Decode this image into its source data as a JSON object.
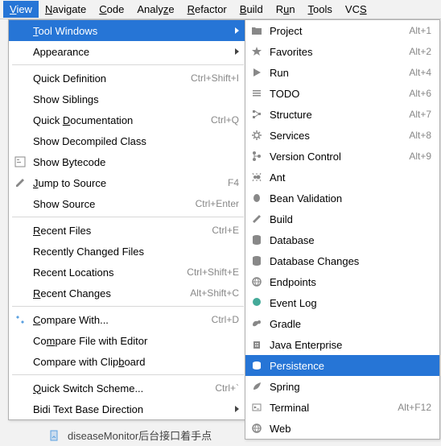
{
  "menubar": {
    "view": "View",
    "view_mn": "V",
    "navigate": "Navigate",
    "navigate_mn": "N",
    "code": "Code",
    "code_mn": "C",
    "analyze": "Analyze",
    "analyze_mn": "z",
    "refactor": "Refactor",
    "refactor_mn": "R",
    "build": "Build",
    "build_mn": "B",
    "run": "Run",
    "run_mn": "u",
    "tools": "Tools",
    "tools_mn": "T",
    "vcs": "VCS",
    "vcs_mn": "S"
  },
  "view_menu": {
    "tool_windows": "Tool Windows",
    "tw_mn": "T",
    "appearance": "Appearance",
    "quick_def": "Quick Definition",
    "quick_def_sc": "Ctrl+Shift+I",
    "show_siblings": "Show Siblings",
    "quick_doc": "Quick Documentation",
    "quick_doc_mn": "D",
    "quick_doc_sc": "Ctrl+Q",
    "show_decompiled": "Show Decompiled Class",
    "show_bytecode": "Show Bytecode",
    "jump_source": "Jump to Source",
    "jump_mn": "J",
    "jump_sc": "F4",
    "show_source": "Show Source",
    "show_source_sc": "Ctrl+Enter",
    "recent_files": "Recent Files",
    "rf_mn": "R",
    "rf_sc": "Ctrl+E",
    "recently_changed": "Recently Changed Files",
    "recent_locations": "Recent Locations",
    "rl_sc": "Ctrl+Shift+E",
    "recent_changes": "Recent Changes",
    "rc_mn": "R",
    "rc_sc": "Alt+Shift+C",
    "compare_with": "Compare With...",
    "cw_mn": "C",
    "cw_sc": "Ctrl+D",
    "compare_file_editor": "Compare File with Editor",
    "cfe_mn": "m",
    "compare_clipboard": "Compare with Clipboard",
    "cc_mn": "b",
    "quick_switch": "Quick Switch Scheme...",
    "qs_mn": "Q",
    "qs_sc": "Ctrl+`",
    "bidi": "Bidi Text Base Direction"
  },
  "tool_windows": {
    "project": "Project",
    "project_sc": "Alt+1",
    "favorites": "Favorites",
    "fav_sc": "Alt+2",
    "run": "Run",
    "run_sc": "Alt+4",
    "todo": "TODO",
    "todo_sc": "Alt+6",
    "structure": "Structure",
    "struct_sc": "Alt+7",
    "services": "Services",
    "serv_sc": "Alt+8",
    "version_control": "Version Control",
    "vc_sc": "Alt+9",
    "ant": "Ant",
    "bean_validation": "Bean Validation",
    "build": "Build",
    "database": "Database",
    "database_changes": "Database Changes",
    "endpoints": "Endpoints",
    "event_log": "Event Log",
    "gradle": "Gradle",
    "java_enterprise": "Java Enterprise",
    "persistence": "Persistence",
    "spring": "Spring",
    "terminal": "Terminal",
    "term_sc": "Alt+F12",
    "web": "Web"
  },
  "bottom": {
    "text": "diseaseMonitor后台接口着手点"
  }
}
